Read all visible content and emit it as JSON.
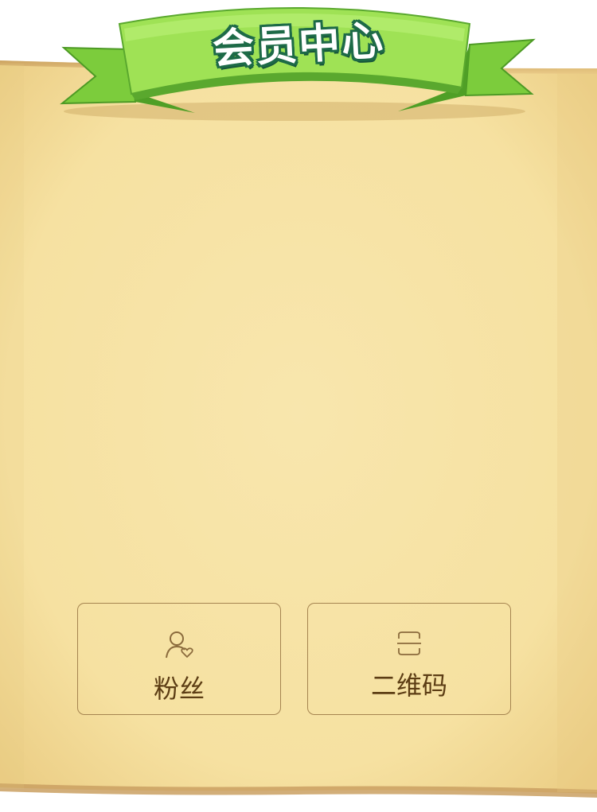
{
  "header": {
    "title": "会员中心",
    "ribbon_color": "#8fdc4a",
    "title_outline_color": "#1d6a47"
  },
  "background": {
    "parchment_color": "#f6e4a8",
    "edge_color": "#d9b46e"
  },
  "actions": [
    {
      "label": "粉丝",
      "icon": "user-heart-icon"
    },
    {
      "label": "二维码",
      "icon": "qr-code-icon"
    }
  ],
  "card_border_color": "#a58450",
  "label_color": "#5c3d14"
}
